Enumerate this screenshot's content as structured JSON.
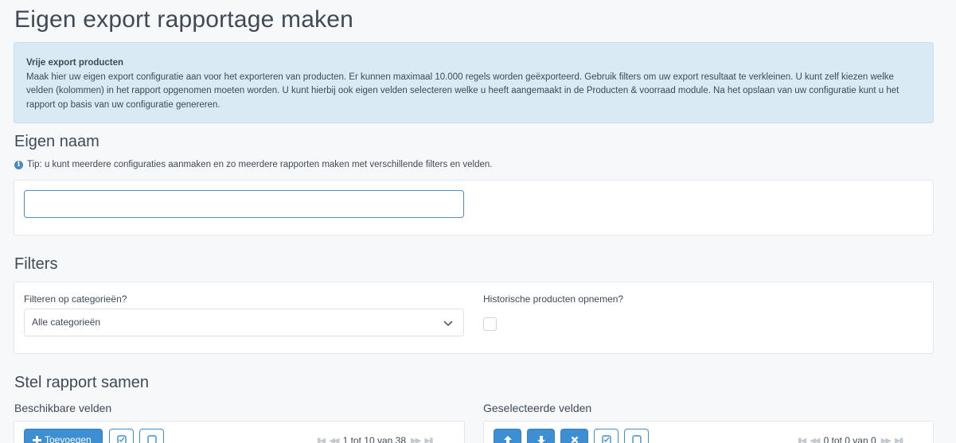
{
  "page": {
    "title": "Eigen export rapportage maken"
  },
  "info": {
    "title": "Vrije export producten",
    "text": "Maak hier uw eigen export configuratie aan voor het exporteren van producten. Er kunnen maximaal 10.000 regels worden geëxporteerd. Gebruik filters om uw export resultaat te verkleinen. U kunt zelf kiezen welke velden (kolommen) in het rapport opgenomen moeten worden. U kunt hierbij ook eigen velden selecteren welke u heeft aangemaakt in de Producten & voorraad module. Na het opslaan van uw configuratie kunt u het rapport op basis van uw configuratie genereren."
  },
  "name_section": {
    "title": "Eigen naam",
    "tip": "Tip: u kunt meerdere configuraties aanmaken en zo meerdere rapporten maken met verschillende filters en velden.",
    "input_value": ""
  },
  "filters": {
    "title": "Filters",
    "category_label": "Filteren op categorieën?",
    "category_value": "Alle categorieën",
    "historic_label": "Historische producten opnemen?",
    "historic_checked": false
  },
  "compose": {
    "title": "Stel rapport samen",
    "available_label": "Beschikbare velden",
    "selected_label": "Geselecteerde velden",
    "add_button": "Toevoegen",
    "available_pager": "1 tot 10 van 38",
    "selected_pager": "0 tot 0 van 0"
  },
  "colors": {
    "accent": "#3d8fd1",
    "info_bg": "#d9eaf5"
  },
  "icons": [
    "info-icon",
    "chevron-down-icon",
    "plus-icon",
    "check-all-icon",
    "uncheck-all-icon",
    "arrow-up-icon",
    "arrow-down-icon",
    "remove-icon",
    "first-page-icon",
    "prev-page-icon",
    "next-page-icon",
    "last-page-icon"
  ]
}
